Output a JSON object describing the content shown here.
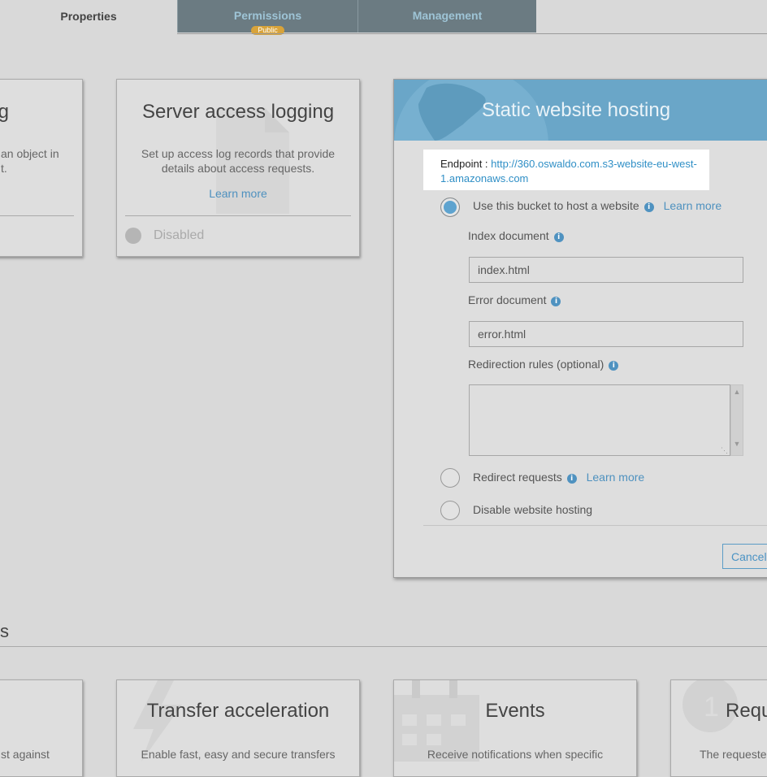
{
  "tabs": {
    "properties": "Properties",
    "permissions": "Permissions",
    "permissions_badge": "Public",
    "management": "Management"
  },
  "left_card": {
    "title": "g",
    "desc_line1": "an object in",
    "desc_line2": "t."
  },
  "logging_card": {
    "title": "Server access logging",
    "description": "Set up access log records that provide details about access requests.",
    "learn_more": "Learn more",
    "status": "Disabled"
  },
  "hosting": {
    "title": "Static website hosting",
    "endpoint_label": "Endpoint :",
    "endpoint_url": "http://360.oswaldo.com.s3-website-eu-west-1.amazonaws.com",
    "option_host": "Use this bucket to host a website",
    "learn_more": "Learn more",
    "index_label": "Index document",
    "index_value": "index.html",
    "error_label": "Error document",
    "error_value": "error.html",
    "redirection_label": "Redirection rules (optional)",
    "redirection_value": "",
    "option_redirect": "Redirect requests",
    "option_disable": "Disable website hosting",
    "cancel": "Cancel"
  },
  "section_title": "s",
  "bottom": {
    "left_desc": "st against",
    "transfer_title": "Transfer acceleration",
    "transfer_desc": "Enable fast, easy and secure transfers",
    "events_title": "Events",
    "events_desc": "Receive notifications when specific",
    "req_title": "Requ",
    "req_desc": "The requeste"
  },
  "colors": {
    "accent": "#4e91bf",
    "header": "#6aa6c8",
    "tab_dark": "#6b7b82",
    "badge": "#d8a33a"
  }
}
